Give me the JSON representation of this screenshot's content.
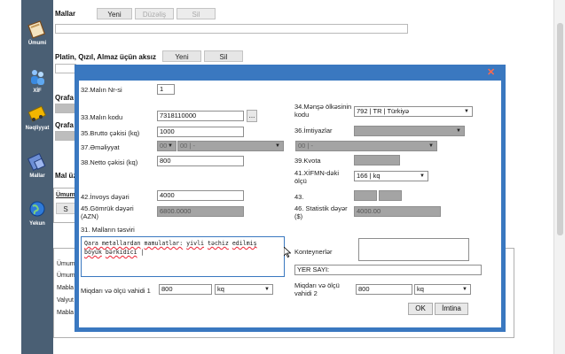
{
  "sidebar": {
    "items": [
      {
        "label": "Ümumi",
        "icon": "book-icon"
      },
      {
        "label": "XİF",
        "icon": "people-icon"
      },
      {
        "label": "Nəqliyyat",
        "icon": "truck-icon"
      },
      {
        "label": "Mallar",
        "icon": "boxes-icon"
      },
      {
        "label": "Yekun",
        "icon": "globe-icon"
      }
    ]
  },
  "background": {
    "section_title": "Mallar",
    "btn_new": "Yeni",
    "btn_edit": "Düzəliş",
    "btn_delete": "Sil",
    "metals_title": "Platin, Qızıl, Almaz üçün aksız",
    "metals_new": "Yeni",
    "metals_delete": "Sil",
    "frag_qrafa1": "Qrafa",
    "frag_qrafa2": "Qrafa",
    "frag_mal": "Mal üz",
    "frag_umum": "Ümum",
    "frag_s": "S",
    "list_1": "Ümum",
    "list_2": "Ümum",
    "list_3": "Mabla",
    "list_4": "Valyut",
    "list_5": "Mabla"
  },
  "dialog": {
    "close_glyph": "✕",
    "f32_label": "32.Malın Nr-si",
    "f32_value": "1",
    "f33_label": "33.Malın kodu",
    "f33_value": "7318110000",
    "f33_btn": "...",
    "f34_label": "34.Mənşə ölkəsinin kodu",
    "f34_value": "792 | TR | Türkiyə",
    "f35_label": "35.Brutto çəkisi (kq)",
    "f35_value": "1000",
    "f36_label": "36.İmtiyazlar",
    "f37_label": "37.Əməliyyat",
    "f37_a": "00",
    "f37_b": "00 | -",
    "f37_c": "00 | -",
    "f38_label": "38.Netto çəkisi (kq)",
    "f38_value": "800",
    "f39_label": "39.Kvota",
    "f41_label": "41.XİFMN-dəki ölçü",
    "f41_value": "166 | kq",
    "f42_label": "42.İnvoys dəyəri",
    "f42_value": "4000",
    "f43_label": "43.",
    "f45_label": "45.Gömrük dəyəri (AZN)",
    "f45_value": "6800.0000",
    "f46_label": "46. Statistik dəyər ($)",
    "f46_value": "4000.00",
    "f31_label": "31. Malların təsviri",
    "f31_text_1": "Qara metallardan",
    "f31_text_2": "mamulatlar:",
    "f31_text_3": "yivli",
    "f31_text_4": "təchiz",
    "f31_text_5": "edilmiş",
    "f31_text_6": "böyük",
    "f31_text_7": "bərkidici",
    "konteyner_label": "Konteynerlər",
    "yer_sayi": "YER SAYI:",
    "qty1_label": "Miqdarı və ölçü vahidi 1",
    "qty1_value": "800",
    "qty1_unit": "kq",
    "qty2_label": "Miqdarı və ölçü vahidi 2",
    "qty2_value": "800",
    "qty2_unit": "kq",
    "ok": "OK",
    "cancel": "İmtina"
  }
}
